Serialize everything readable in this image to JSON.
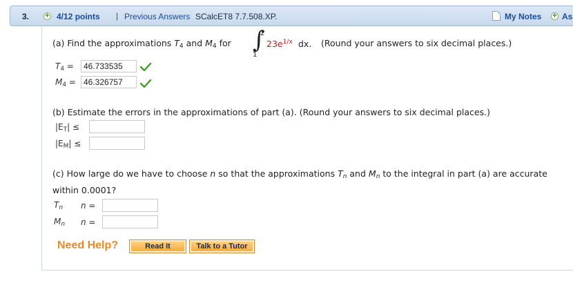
{
  "header": {
    "question_number": "3.",
    "points": "4/12 points",
    "separator": "|",
    "previous_answers": "Previous Answers",
    "problem_id": "SCalcET8 7.7.508.XP.",
    "my_notes": "My Notes",
    "ask": "Ask Y"
  },
  "part_a": {
    "prompt_start": "(a) Find the approximations ",
    "and": " and ",
    "for": " for",
    "integral": {
      "lower": "1",
      "upper": "2",
      "coef": "23e",
      "exp": "1/x",
      "dx": "dx."
    },
    "instruction": "(Round your answers to six decimal places.)",
    "t4_label": "T",
    "t4_sub": "4",
    "m4_label": "M",
    "m4_sub": "4",
    "equals": " =",
    "t4_value": "46.733535",
    "m4_value": "46.326757"
  },
  "part_b": {
    "prompt": "(b) Estimate the errors in the approximations of part (a). (Round your answers to six decimal places.)",
    "et_label_pre": "|E",
    "et_sub": "T",
    "leq": "| ≤",
    "em_label_pre": "|E",
    "em_sub": "M"
  },
  "part_c": {
    "prompt_start": "(c) How large do we have to choose ",
    "n": "n",
    "prompt_mid": " so that the approximations ",
    "tn": "T",
    "and": " and ",
    "mn": "M",
    "sub_n": "n",
    "prompt_end": " to the integral in part (a) are accurate",
    "line2": "within 0.0001?",
    "row_tn": "T",
    "row_mn": "M",
    "n_equals": "n ="
  },
  "help": {
    "need_help": "Need Help?",
    "read_it": "Read It",
    "talk_to_tutor": "Talk to a Tutor"
  },
  "colors": {
    "header_bg": "#c9d9ee",
    "link": "#1a4c96",
    "integrand": "#c2181b",
    "check": "#3f9c2a",
    "help_orange": "#e98a2a"
  },
  "icons": [
    "plus-icon",
    "note-icon",
    "check-icon"
  ]
}
